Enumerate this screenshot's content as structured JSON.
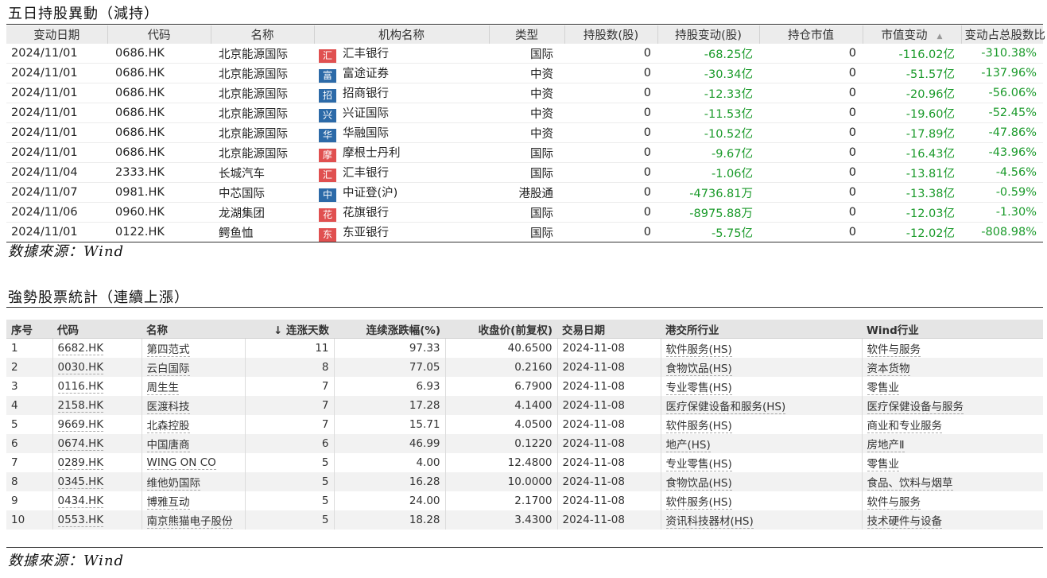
{
  "section1": {
    "title": "五日持股異動（減持）",
    "columns": [
      "变动日期",
      "代码",
      "名称",
      "机构名称",
      "类型",
      "持股数(股)",
      "持股变动(股)",
      "持仓市值",
      "市值变动",
      "变动占总股数比"
    ],
    "sort_indicator": "▲",
    "rows": [
      {
        "date": "2024/11/01",
        "code": "0686.HK",
        "name": "北京能源国际",
        "logo": "汇",
        "logo_color": "#e05050",
        "inst": "汇丰银行",
        "type": "国际",
        "shares": "0",
        "change": "-68.25亿",
        "value": "0",
        "value_change": "-116.02亿",
        "ratio": "-310.38%"
      },
      {
        "date": "2024/11/01",
        "code": "0686.HK",
        "name": "北京能源国际",
        "logo": "富",
        "logo_color": "#2c6aa8",
        "inst": "富途证券",
        "type": "中资",
        "shares": "0",
        "change": "-30.34亿",
        "value": "0",
        "value_change": "-51.57亿",
        "ratio": "-137.96%"
      },
      {
        "date": "2024/11/01",
        "code": "0686.HK",
        "name": "北京能源国际",
        "logo": "招",
        "logo_color": "#2c6aa8",
        "inst": "招商银行",
        "type": "中资",
        "shares": "0",
        "change": "-12.33亿",
        "value": "0",
        "value_change": "-20.96亿",
        "ratio": "-56.06%"
      },
      {
        "date": "2024/11/01",
        "code": "0686.HK",
        "name": "北京能源国际",
        "logo": "兴",
        "logo_color": "#2c6aa8",
        "inst": "兴证国际",
        "type": "中资",
        "shares": "0",
        "change": "-11.53亿",
        "value": "0",
        "value_change": "-19.60亿",
        "ratio": "-52.45%"
      },
      {
        "date": "2024/11/01",
        "code": "0686.HK",
        "name": "北京能源国际",
        "logo": "华",
        "logo_color": "#2c6aa8",
        "inst": "华融国际",
        "type": "中资",
        "shares": "0",
        "change": "-10.52亿",
        "value": "0",
        "value_change": "-17.89亿",
        "ratio": "-47.86%"
      },
      {
        "date": "2024/11/01",
        "code": "0686.HK",
        "name": "北京能源国际",
        "logo": "摩",
        "logo_color": "#e05050",
        "inst": "摩根士丹利",
        "type": "国际",
        "shares": "0",
        "change": "-9.67亿",
        "value": "0",
        "value_change": "-16.43亿",
        "ratio": "-43.96%"
      },
      {
        "date": "2024/11/04",
        "code": "2333.HK",
        "name": "长城汽车",
        "logo": "汇",
        "logo_color": "#e05050",
        "inst": "汇丰银行",
        "type": "国际",
        "shares": "0",
        "change": "-1.06亿",
        "value": "0",
        "value_change": "-13.81亿",
        "ratio": "-4.56%"
      },
      {
        "date": "2024/11/07",
        "code": "0981.HK",
        "name": "中芯国际",
        "logo": "中",
        "logo_color": "#2c6aa8",
        "inst": "中证登(沪)",
        "type": "港股通",
        "shares": "0",
        "change": "-4736.81万",
        "value": "0",
        "value_change": "-13.38亿",
        "ratio": "-0.59%"
      },
      {
        "date": "2024/11/06",
        "code": "0960.HK",
        "name": "龙湖集团",
        "logo": "花",
        "logo_color": "#e05050",
        "inst": "花旗银行",
        "type": "国际",
        "shares": "0",
        "change": "-8975.88万",
        "value": "0",
        "value_change": "-12.03亿",
        "ratio": "-1.30%"
      },
      {
        "date": "2024/11/01",
        "code": "0122.HK",
        "name": "鳄鱼恤",
        "logo": "东",
        "logo_color": "#e05050",
        "inst": "东亚银行",
        "type": "国际",
        "shares": "0",
        "change": "-5.75亿",
        "value": "0",
        "value_change": "-12.02亿",
        "ratio": "-808.98%"
      }
    ],
    "source": "数據來源：Wind"
  },
  "section2": {
    "title": "強勢股票統計（連續上漲）",
    "columns": [
      "序号",
      "代码",
      "名称",
      "↓ 连涨天数",
      "连续涨跌幅(%)",
      "收盘价(前复权)",
      "交易日期",
      "港交所行业",
      "Wind行业"
    ],
    "rows": [
      {
        "no": "1",
        "code": "6682.HK",
        "name": "第四范式",
        "days": "11",
        "pct": "97.33",
        "close": "40.6500",
        "date": "2024-11-08",
        "hk_industry": "软件服务(HS)",
        "wind_industry": "软件与服务"
      },
      {
        "no": "2",
        "code": "0030.HK",
        "name": "云白国际",
        "days": "8",
        "pct": "77.05",
        "close": "0.2160",
        "date": "2024-11-08",
        "hk_industry": "食物饮品(HS)",
        "wind_industry": "资本货物"
      },
      {
        "no": "3",
        "code": "0116.HK",
        "name": "周生生",
        "days": "7",
        "pct": "6.93",
        "close": "6.7900",
        "date": "2024-11-08",
        "hk_industry": "专业零售(HS)",
        "wind_industry": "零售业"
      },
      {
        "no": "4",
        "code": "2158.HK",
        "name": "医渡科技",
        "days": "7",
        "pct": "17.28",
        "close": "4.1400",
        "date": "2024-11-08",
        "hk_industry": "医疗保健设备和服务(HS)",
        "wind_industry": "医疗保健设备与服务"
      },
      {
        "no": "5",
        "code": "9669.HK",
        "name": "北森控股",
        "days": "7",
        "pct": "15.71",
        "close": "4.0500",
        "date": "2024-11-08",
        "hk_industry": "软件服务(HS)",
        "wind_industry": "商业和专业服务"
      },
      {
        "no": "6",
        "code": "0674.HK",
        "name": "中国唐商",
        "days": "6",
        "pct": "46.99",
        "close": "0.1220",
        "date": "2024-11-08",
        "hk_industry": "地产(HS)",
        "wind_industry": "房地产Ⅱ"
      },
      {
        "no": "7",
        "code": "0289.HK",
        "name": "WING ON CO",
        "days": "5",
        "pct": "4.00",
        "close": "12.4800",
        "date": "2024-11-08",
        "hk_industry": "专业零售(HS)",
        "wind_industry": "零售业"
      },
      {
        "no": "8",
        "code": "0345.HK",
        "name": "维他奶国际",
        "days": "5",
        "pct": "16.28",
        "close": "10.0000",
        "date": "2024-11-08",
        "hk_industry": "食物饮品(HS)",
        "wind_industry": "食品、饮料与烟草"
      },
      {
        "no": "9",
        "code": "0434.HK",
        "name": "博雅互动",
        "days": "5",
        "pct": "24.00",
        "close": "2.1700",
        "date": "2024-11-08",
        "hk_industry": "软件服务(HS)",
        "wind_industry": "软件与服务"
      },
      {
        "no": "10",
        "code": "0553.HK",
        "name": "南京熊猫电子股份",
        "days": "5",
        "pct": "18.28",
        "close": "3.4300",
        "date": "2024-11-08",
        "hk_industry": "资讯科技器材(HS)",
        "wind_industry": "技术硬件与设备"
      }
    ],
    "source": "数據來源：Wind"
  }
}
